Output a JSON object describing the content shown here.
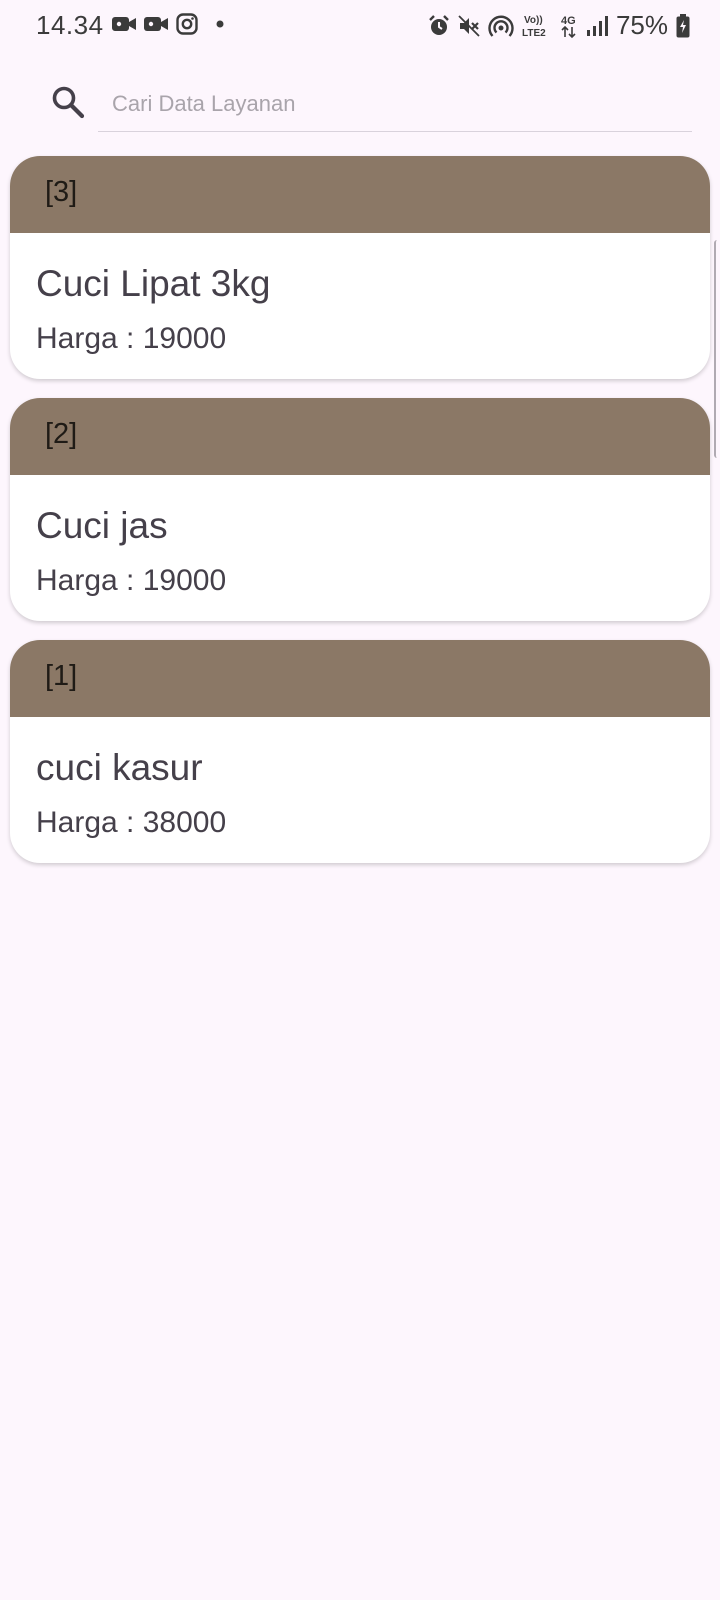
{
  "status_bar": {
    "time": "14.34",
    "battery": "75%",
    "left_icons": [
      "video-camera-icon",
      "video-camera-icon",
      "instagram-icon",
      "dot-icon"
    ],
    "right_icons": [
      "alarm-icon",
      "mute-icon",
      "hotspot-icon",
      "volte-icon",
      "4g-icon",
      "signal-icon",
      "battery-icon"
    ],
    "volte_label": "Vo))\nLTE2",
    "network_label": "4G"
  },
  "search": {
    "placeholder": "Cari Data Layanan",
    "value": ""
  },
  "services": [
    {
      "id": "[3]",
      "name": "Cuci Lipat 3kg",
      "price": "Harga : 19000"
    },
    {
      "id": "[2]",
      "name": "Cuci jas",
      "price": "Harga : 19000"
    },
    {
      "id": "[1]",
      "name": "cuci kasur",
      "price": "Harga : 38000"
    }
  ],
  "colors": {
    "background": "#fdf6fd",
    "card_header": "#8b7866",
    "card_body": "#ffffff",
    "text": "#45404a"
  }
}
